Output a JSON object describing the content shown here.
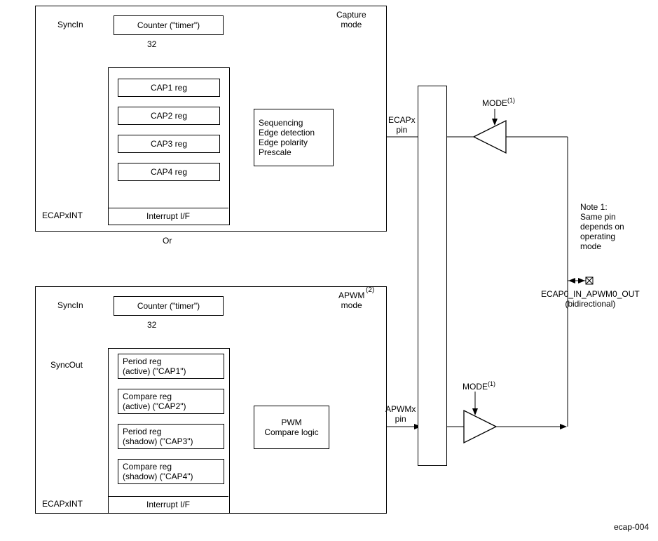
{
  "capture": {
    "title": "Capture\nmode",
    "syncin": "SyncIn",
    "counter": "Counter (\"timer\")",
    "bus": "32",
    "cap1": "CAP1 reg",
    "cap2": "CAP2 reg",
    "cap3": "CAP3 reg",
    "cap4": "CAP4 reg",
    "intif": "Interrupt I/F",
    "ecapint": "ECAPxINT",
    "seq": "Sequencing\nEdge detection\nEdge polarity\nPrescale"
  },
  "or": "Or",
  "apwm": {
    "title": "APWM\nmode",
    "sup": "(2)",
    "syncin": "SyncIn",
    "counter": "Counter (\"timer\")",
    "bus": "32",
    "period_active": "Period reg\n(active) (\"CAP1\")",
    "compare_active": "Compare reg\n(active) (\"CAP2\")",
    "period_shadow": "Period reg\n(shadow) (\"CAP3\")",
    "compare_shadow": "Compare reg\n(shadow) (\"CAP4\")",
    "intif": "Interrupt I/F",
    "ecapint": "ECAPxINT",
    "syncout": "SyncOut",
    "pwm": "PWM\nCompare logic"
  },
  "pins": {
    "ecapx": "ECAPx\npin",
    "apwmx": "APWMx\npin",
    "mode1": "MODE",
    "mode1_sup": "(1)",
    "mode2": "MODE",
    "mode2_sup": "(1)"
  },
  "note": "Note 1:\nSame pin\ndepends on\noperating\nmode",
  "bidir": "ECAP0_IN_APWM0_OUT\n(bidirectional)",
  "ecap004": "ecap-004"
}
